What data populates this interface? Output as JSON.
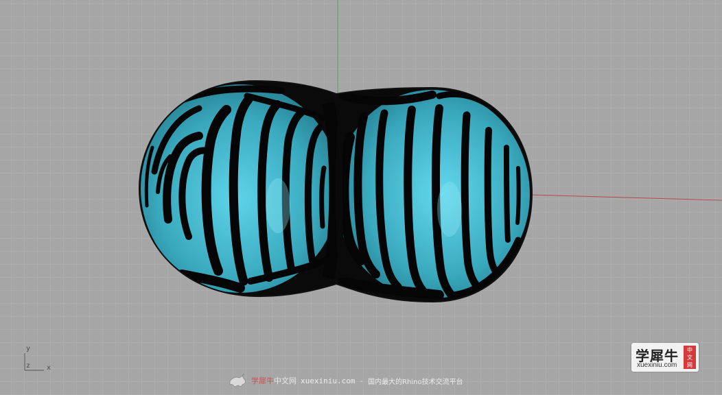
{
  "viewport": {
    "background": "#a6a6a6",
    "grid_color": "#b4b4b4",
    "x_axis_color": "#b54a4a",
    "y_axis_color": "#3fa53f",
    "object_color": "#3fb6cc",
    "stripe_color": "#000000",
    "axis_icon": {
      "y_label": "y",
      "z_label": "z",
      "x_label": "x"
    }
  },
  "watermark": {
    "brand": "学犀牛",
    "cn": "中文网",
    "url": "xuexiniu.com",
    "separator": "-",
    "desc": "国内最大的Rhino技术交流平台",
    "icon": "rhino-icon"
  },
  "logo": {
    "title": "学犀牛",
    "url": "xuexiniu.com",
    "badge_top": "中",
    "badge_mid": "文",
    "badge_bot": "网"
  }
}
